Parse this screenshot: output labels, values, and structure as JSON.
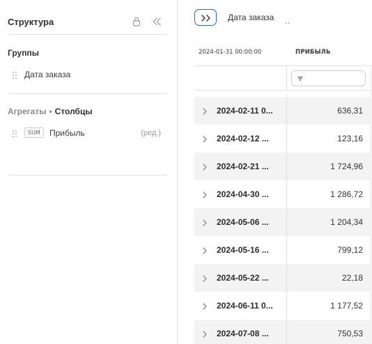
{
  "panel": {
    "title": "Структура",
    "groups_title": "Группы",
    "group_field": "Дата заказа",
    "aggregates_title_a": "Агрегаты",
    "aggregates_title_dot": "•",
    "aggregates_title_b": "Столбцы",
    "agg_badge": "SUM",
    "agg_field": "Прибыль",
    "agg_edit": "(ред.)"
  },
  "toolbar": {
    "expand_button": ">>",
    "pivot_field": "Дата заказа"
  },
  "grid": {
    "col_date_header": "2024-01-31 00:00:00",
    "col_profit_header": "ПРИБЫЛЬ",
    "accent": "#2f5fd0",
    "rows": [
      {
        "date": "2024-02-11 0...",
        "value": "636,31"
      },
      {
        "date": "2024-02-12 ...",
        "value": "123,16"
      },
      {
        "date": "2024-02-21 ...",
        "value": "1 724,96"
      },
      {
        "date": "2024-04-30 ...",
        "value": "1 286,72"
      },
      {
        "date": "2024-05-06 ...",
        "value": "1 204,34"
      },
      {
        "date": "2024-05-16 ...",
        "value": "799,12"
      },
      {
        "date": "2024-05-22 ...",
        "value": "22,18"
      },
      {
        "date": "2024-06-11 0...",
        "value": "1 177,52"
      },
      {
        "date": "2024-07-08 ...",
        "value": "750,53"
      }
    ]
  }
}
